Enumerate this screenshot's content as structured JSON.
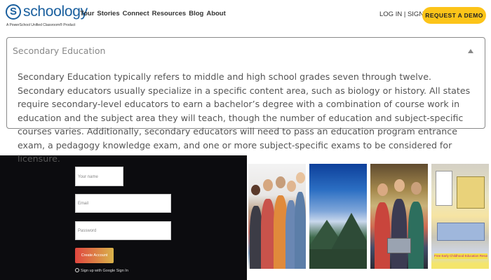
{
  "header": {
    "logo_mark": "S",
    "logo_word": "schoology",
    "logo_tagline": "A PowerSchool Unified Classroom® Product",
    "nav": [
      "Tour",
      "Stories",
      "Connect",
      "Resources",
      "Blog",
      "About"
    ],
    "login_label": "LOG IN | SIGN UP",
    "demo_label": "REQUEST A DEMO",
    "brand_color": "#1a5f9e",
    "accent_color": "#fcc419"
  },
  "accordion": {
    "title": "Secondary Education",
    "expanded": true,
    "body": "Secondary Education typically refers to middle and high school grades seven through twelve. Secondary educators usually specialize in a specific content area, such as biology or history. All states require secondary-level educators to earn a bachelor’s degree with a combination of course work in education and the subject area they will teach, though the number of education and subject-specific courses varies. Additionally, secondary educators will need to pass an education program entrance exam, a pedagogy knowledge exam, and one or more subject-specific exams to be considered for licensure."
  },
  "signup": {
    "name_placeholder": "Your name",
    "email_placeholder": "Email",
    "password_placeholder": "Password",
    "create_label": "Create Account",
    "google_label": "Sign up with Google Sign In"
  },
  "tiles": {
    "banner_text": "Free Early Childhood Education Resources"
  }
}
